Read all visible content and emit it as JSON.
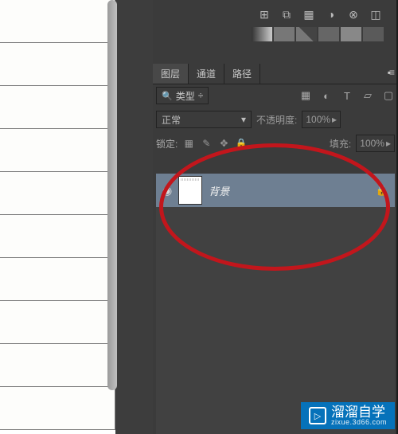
{
  "tabs": {
    "layers": "图层",
    "channels": "通道",
    "paths": "路径"
  },
  "filter": {
    "label": "类型",
    "dd_arrow": "÷"
  },
  "blend": {
    "mode": "正常",
    "opacity_label": "不透明度:",
    "opacity_value": "100%"
  },
  "lock": {
    "label": "锁定:",
    "fill_label": "填充:",
    "fill_value": "100%"
  },
  "layer": {
    "name": "背景"
  },
  "watermark": {
    "brand": "溜溜自学",
    "url": "zixue.3d66.com"
  },
  "icons": {
    "eye": "◉",
    "search": "🔍",
    "image_filter": "▦",
    "adjust": "◐",
    "text": "T",
    "shape": "▱",
    "smart": "▢",
    "lock_transparent": "▦",
    "lock_paint": "✎",
    "lock_move": "✥",
    "lock_all": "🔒",
    "dd_arrow": "▾",
    "dd_small": "▸",
    "menu": "▪≡",
    "play": "▷"
  },
  "palette_row1": {
    "a": "⊞",
    "b": "⧉",
    "c": "▦",
    "d": "◑",
    "e": "⊗",
    "f": "◫"
  },
  "palette_row3": {
    "a": "▤",
    "b": "▥",
    "c": "▧",
    "d": "▨",
    "e": "▩",
    "f": "▦"
  }
}
